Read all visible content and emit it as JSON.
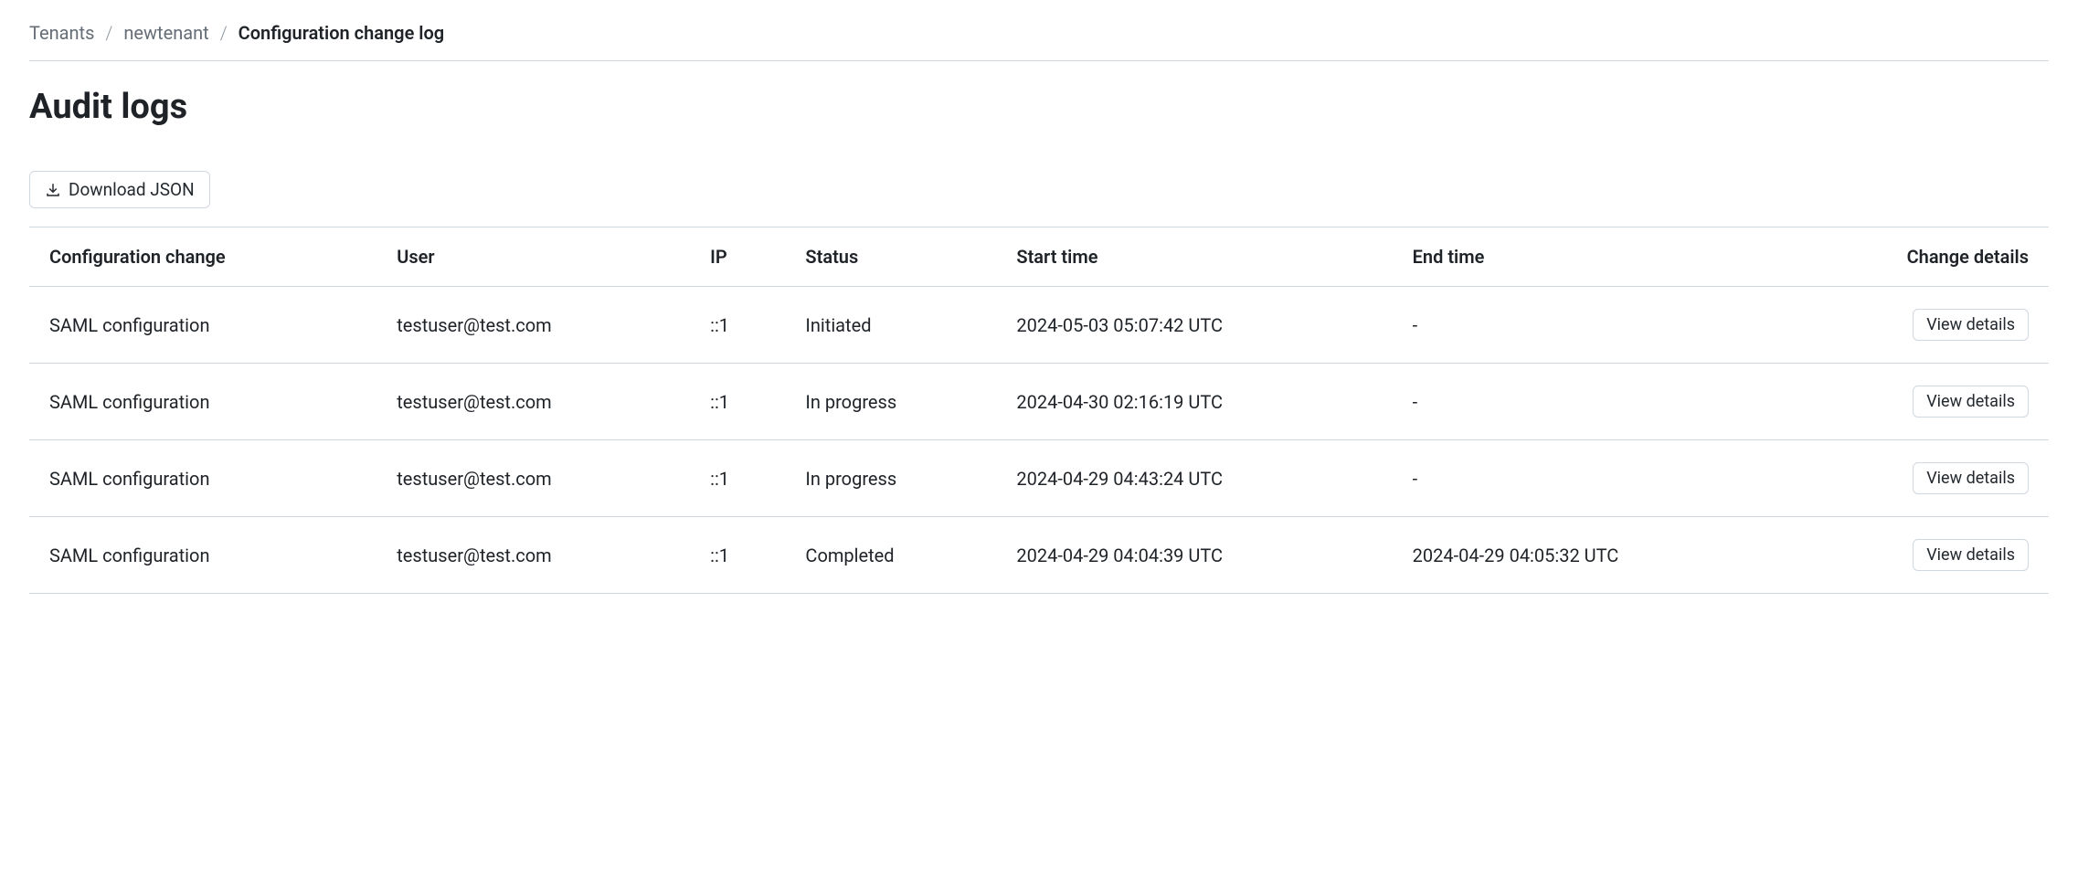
{
  "breadcrumb": {
    "items": [
      {
        "label": "Tenants"
      },
      {
        "label": "newtenant"
      }
    ],
    "current": "Configuration change log"
  },
  "page_title": "Audit logs",
  "download_button": {
    "label": "Download JSON"
  },
  "table": {
    "headers": {
      "config_change": "Configuration change",
      "user": "User",
      "ip": "IP",
      "status": "Status",
      "start_time": "Start time",
      "end_time": "End time",
      "change_details": "Change details"
    },
    "view_details_label": "View details",
    "rows": [
      {
        "config_change": "SAML configuration",
        "user": "testuser@test.com",
        "ip": "::1",
        "status": "Initiated",
        "start_time": "2024-05-03 05:07:42 UTC",
        "end_time": "-"
      },
      {
        "config_change": "SAML configuration",
        "user": "testuser@test.com",
        "ip": "::1",
        "status": "In progress",
        "start_time": "2024-04-30 02:16:19 UTC",
        "end_time": "-"
      },
      {
        "config_change": "SAML configuration",
        "user": "testuser@test.com",
        "ip": "::1",
        "status": "In progress",
        "start_time": "2024-04-29 04:43:24 UTC",
        "end_time": "-"
      },
      {
        "config_change": "SAML configuration",
        "user": "testuser@test.com",
        "ip": "::1",
        "status": "Completed",
        "start_time": "2024-04-29 04:04:39 UTC",
        "end_time": "2024-04-29 04:05:32 UTC"
      }
    ]
  }
}
